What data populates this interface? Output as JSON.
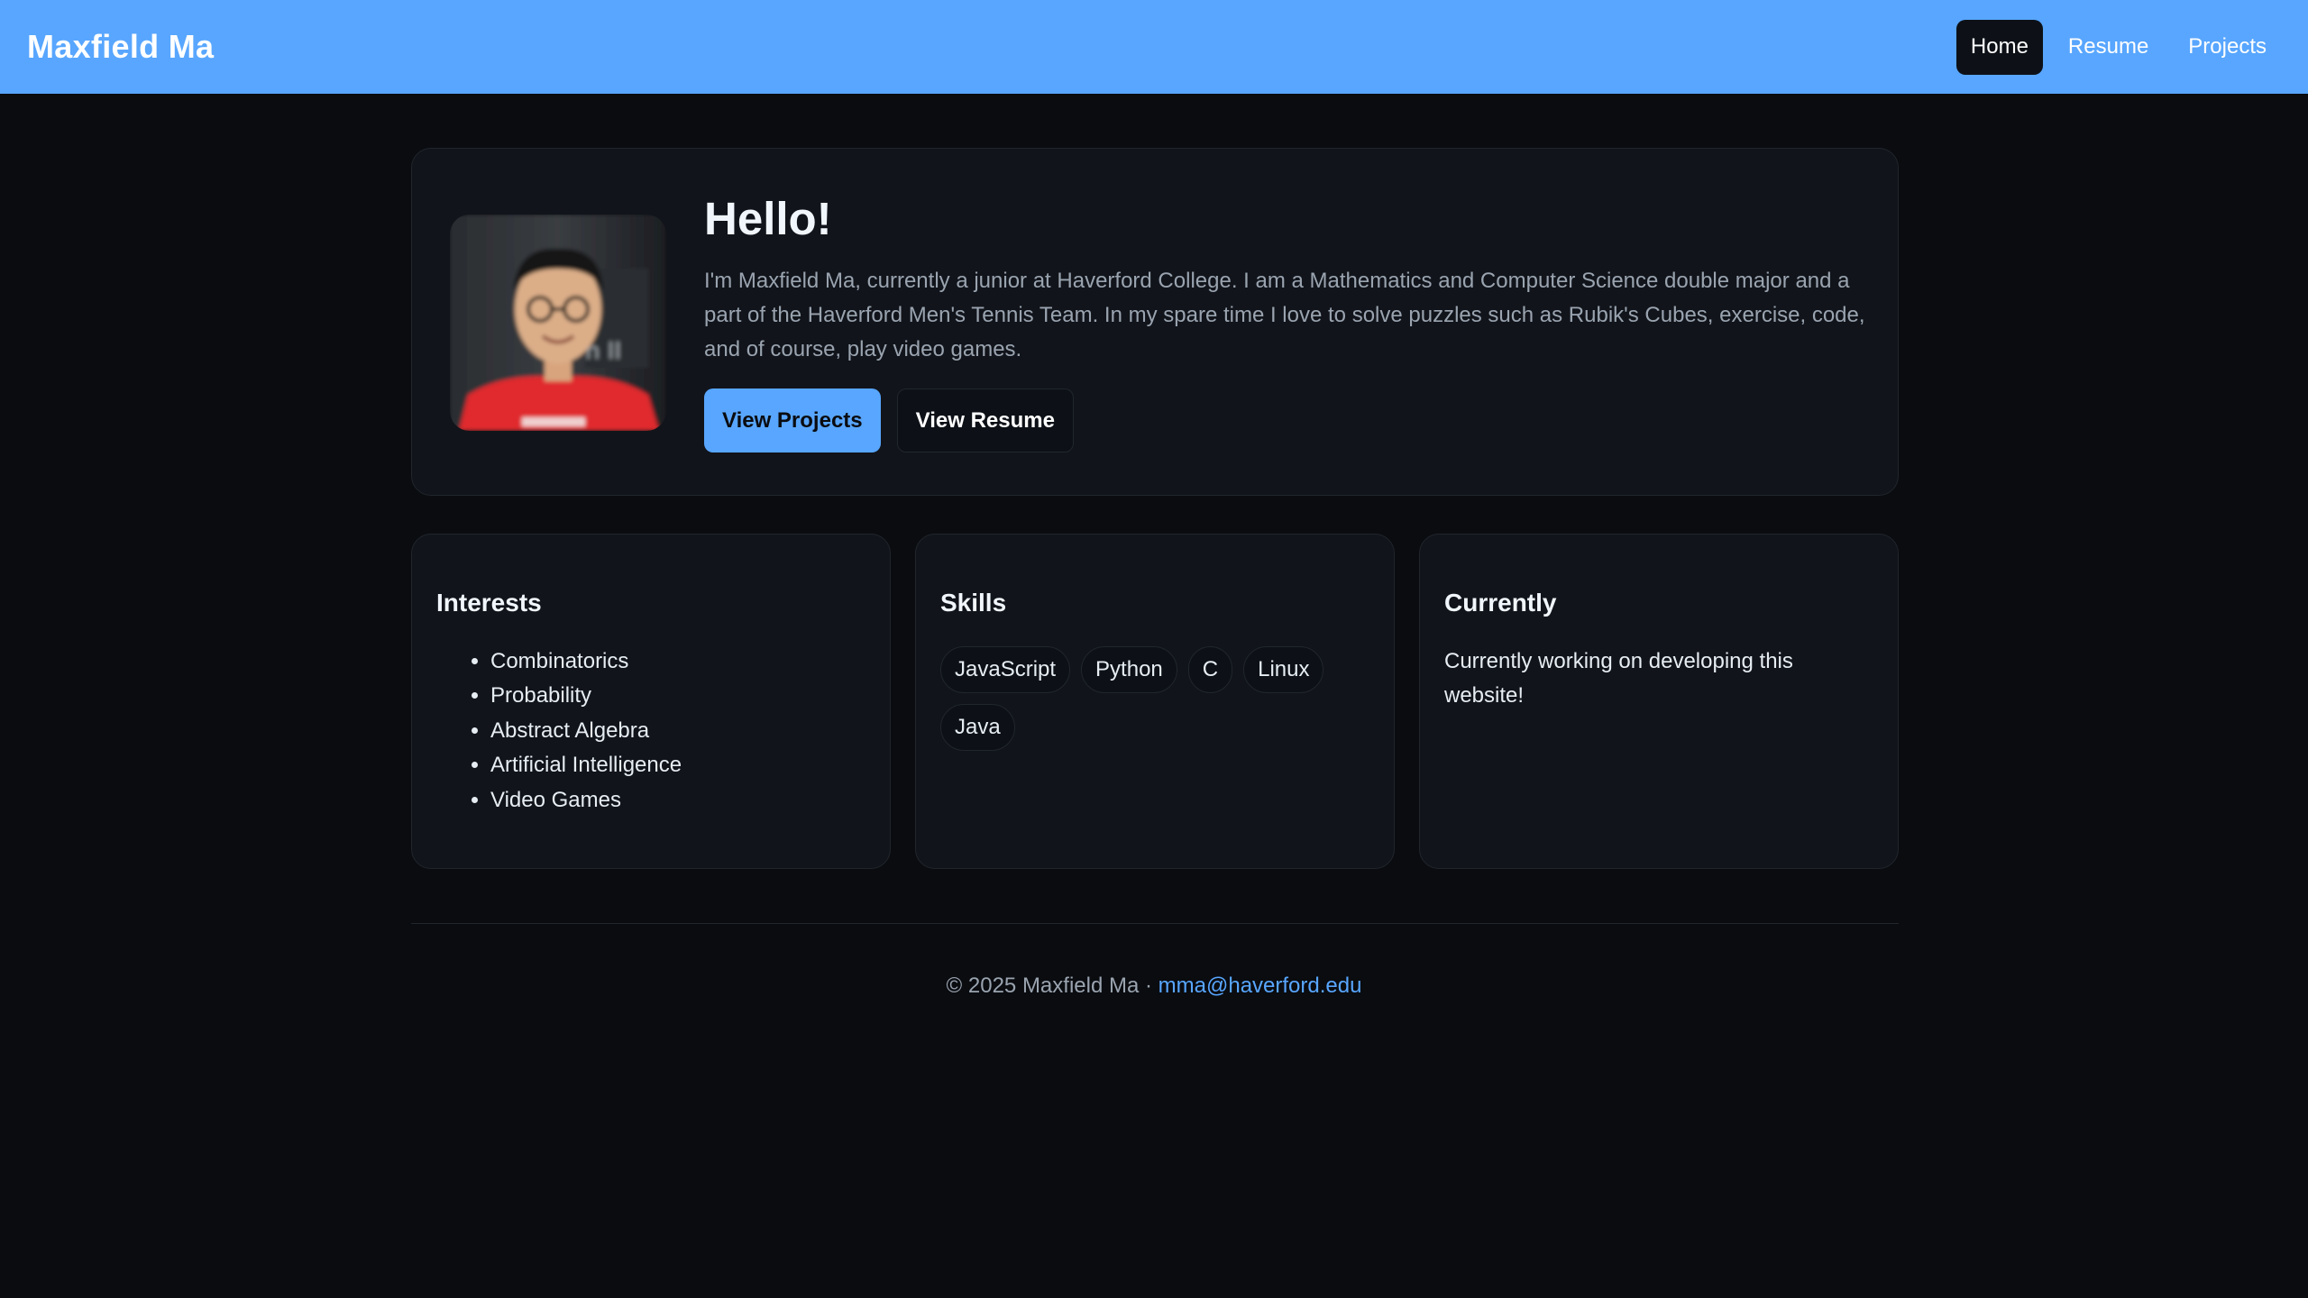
{
  "navbar": {
    "brand": "Maxfield Ma",
    "links": [
      {
        "label": "Home",
        "active": true
      },
      {
        "label": "Resume",
        "active": false
      },
      {
        "label": "Projects",
        "active": false
      }
    ]
  },
  "hero": {
    "title": "Hello!",
    "text": "I'm Maxfield Ma, currently a junior at Haverford College. I am a Mathematics and Computer Science double major and a part of the Haverford Men's Tennis Team. In my spare time I love to solve puzzles such as Rubik's Cubes, exercise, code, and of course, play video games.",
    "primary_button": "View Projects",
    "secondary_button": "View Resume"
  },
  "cards": {
    "interests": {
      "title": "Interests",
      "items": [
        "Combinatorics",
        "Probability",
        "Abstract Algebra",
        "Artificial Intelligence",
        "Video Games"
      ]
    },
    "skills": {
      "title": "Skills",
      "chips": [
        "JavaScript",
        "Python",
        "C",
        "Linux",
        "Java"
      ]
    },
    "currently": {
      "title": "Currently",
      "text": "Currently working on developing this website!"
    }
  },
  "footer": {
    "copyright": "© 2025 Maxfield Ma · ",
    "email": "mma@haverford.edu"
  },
  "colors": {
    "accent": "#58a6ff",
    "background": "#0a0c10",
    "card": "#11141a"
  }
}
